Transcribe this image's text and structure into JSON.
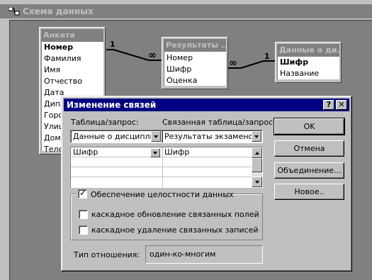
{
  "window": {
    "title": "Схема данных"
  },
  "tables": [
    {
      "title": "Анкета",
      "fields": [
        {
          "name": "Номер",
          "key": true
        },
        {
          "name": "Фамилия",
          "key": false
        },
        {
          "name": "Имя",
          "key": false
        },
        {
          "name": "Отчество",
          "key": false
        },
        {
          "name": "Дата",
          "key": false
        },
        {
          "name": "Дипл",
          "key": false
        },
        {
          "name": "Город",
          "key": false
        },
        {
          "name": "Улиц",
          "key": false
        },
        {
          "name": "Дом",
          "key": false
        },
        {
          "name": "Телес",
          "key": false
        }
      ]
    },
    {
      "title": "Результаты ...",
      "fields": [
        {
          "name": "Номер",
          "key": false
        },
        {
          "name": "Шифр",
          "key": false
        },
        {
          "name": "Оценка",
          "key": false
        }
      ]
    },
    {
      "title": "Данные о ди...",
      "fields": [
        {
          "name": "Шифр",
          "key": true
        },
        {
          "name": "Название",
          "key": false
        }
      ]
    }
  ],
  "relations": [
    {
      "one_label": "1",
      "many_label": "∞"
    },
    {
      "one_label": "1",
      "many_label": "∞"
    }
  ],
  "dialog": {
    "title": "Изменение связей",
    "help_btn": "?",
    "close_btn": "✕",
    "table_label": "Таблица/запрос:",
    "related_label": "Связанная таблица/запрос:",
    "table_value": "Данные о дисциплин",
    "related_value": "Результаты экзаменов",
    "grid_rows": [
      {
        "left": "Шифр",
        "right": "Шифр"
      },
      {
        "left": "",
        "right": ""
      },
      {
        "left": "",
        "right": ""
      },
      {
        "left": "",
        "right": ""
      }
    ],
    "integrity_label": "Обеспечение целостности данных",
    "integrity_checked": true,
    "cascade_update_label": "каскадное обновление связанных полей",
    "cascade_update_checked": false,
    "cascade_delete_label": "каскадное удаление связанных записей",
    "cascade_delete_checked": false,
    "relation_type_label": "Тип отношения:",
    "relation_type_value": "один-ко-многим",
    "buttons": {
      "ok": "OK",
      "cancel": "Отмена",
      "join": "Объединение...",
      "new": "Новое.."
    }
  },
  "colors": {
    "title_active": "#000080",
    "title_inactive": "#808080",
    "face": "#c0c0c0"
  }
}
